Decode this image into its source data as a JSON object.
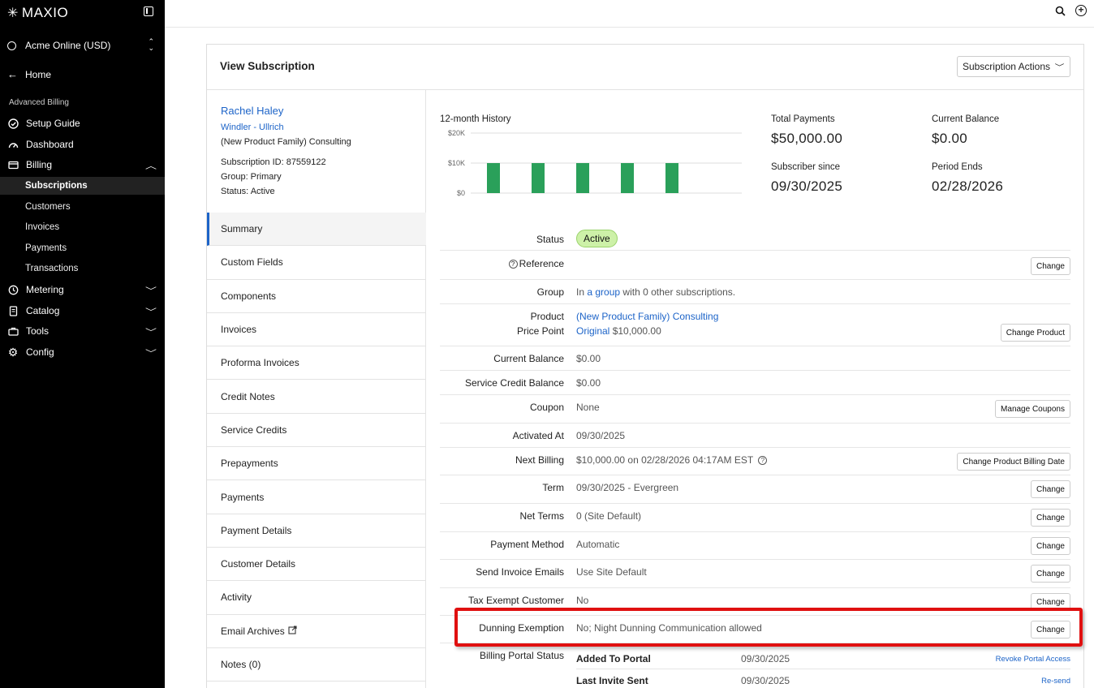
{
  "brand": {
    "name": "MAXIO"
  },
  "sidebar": {
    "site": "Acme Online (USD)",
    "home": "Home",
    "section": "Advanced Billing",
    "items": [
      {
        "label": "Setup Guide",
        "icon": "check-circle-icon"
      },
      {
        "label": "Dashboard",
        "icon": "gauge-icon"
      },
      {
        "label": "Billing",
        "icon": "credit-card-icon",
        "expanded": true
      },
      {
        "label": "Metering",
        "icon": "history-icon"
      },
      {
        "label": "Catalog",
        "icon": "document-icon"
      },
      {
        "label": "Tools",
        "icon": "toolbox-icon"
      },
      {
        "label": "Config",
        "icon": "gear-icon"
      }
    ],
    "billing_sub": [
      "Subscriptions",
      "Customers",
      "Invoices",
      "Payments",
      "Transactions"
    ]
  },
  "page": {
    "title": "View Subscription",
    "actions": "Subscription Actions"
  },
  "customer": {
    "name": "Rachel Haley",
    "org": "Windler - Ullrich",
    "product": "(New Product Family) Consulting",
    "subscription_id": "Subscription ID: 87559122",
    "group": "Group: Primary",
    "status": "Status: Active"
  },
  "tabs": [
    "Summary",
    "Custom Fields",
    "Components",
    "Invoices",
    "Proforma Invoices",
    "Credit Notes",
    "Service Credits",
    "Prepayments",
    "Payments",
    "Payment Details",
    "Customer Details",
    "Activity",
    "Email Archives",
    "Notes (0)"
  ],
  "chart_data": {
    "type": "bar",
    "title": "12-month History",
    "yticks": [
      "$20K",
      "$10K",
      "$0"
    ],
    "ylim": [
      0,
      20000
    ],
    "values": [
      10000,
      10000,
      10000,
      10000,
      10000
    ],
    "color": "#2aa05a"
  },
  "stats": {
    "total_payments_label": "Total Payments",
    "total_payments": "$50,000.00",
    "current_balance_label": "Current Balance",
    "current_balance": "$0.00",
    "subscriber_since_label": "Subscriber since",
    "subscriber_since": "09/30/2025",
    "period_ends_label": "Period Ends",
    "period_ends": "02/28/2026"
  },
  "details": {
    "status_label": "Status",
    "status_value": "Active",
    "reference_label": "Reference",
    "group_label": "Group",
    "group_pre": "In",
    "group_link": "a group",
    "group_post": "with 0 other subscriptions.",
    "product_label": "Product",
    "price_point_label": "Price Point",
    "product_value": "(New Product Family) Consulting",
    "price_point_link": "Original",
    "price_point_amount": "$10,000.00",
    "current_balance_label": "Current Balance",
    "current_balance_value": "$0.00",
    "service_credit_label": "Service Credit Balance",
    "service_credit_value": "$0.00",
    "coupon_label": "Coupon",
    "coupon_value": "None",
    "activated_label": "Activated At",
    "activated_value": "09/30/2025",
    "next_billing_label": "Next Billing",
    "next_billing_value": "$10,000.00 on 02/28/2026 04:17AM EST",
    "term_label": "Term",
    "term_value": "09/30/2025 - Evergreen",
    "net_terms_label": "Net Terms",
    "net_terms_value": "0 (Site Default)",
    "payment_method_label": "Payment Method",
    "payment_method_value": "Automatic",
    "send_invoice_label": "Send Invoice Emails",
    "send_invoice_value": "Use Site Default",
    "tax_exempt_label": "Tax Exempt Customer",
    "tax_exempt_value": "No",
    "dunning_label": "Dunning Exemption",
    "dunning_value": "No; Night Dunning Communication allowed",
    "portal_label": "Billing Portal Status",
    "added_portal_label": "Added To Portal",
    "added_portal_value": "09/30/2025",
    "last_invite_label": "Last Invite Sent",
    "last_invite_value": "09/30/2025"
  },
  "buttons": {
    "change": "Change",
    "change_product": "Change Product",
    "manage_coupons": "Manage Coupons",
    "change_billing_date": "Change Product Billing Date",
    "revoke_portal": "Revoke Portal Access",
    "resend": "Re-send"
  }
}
